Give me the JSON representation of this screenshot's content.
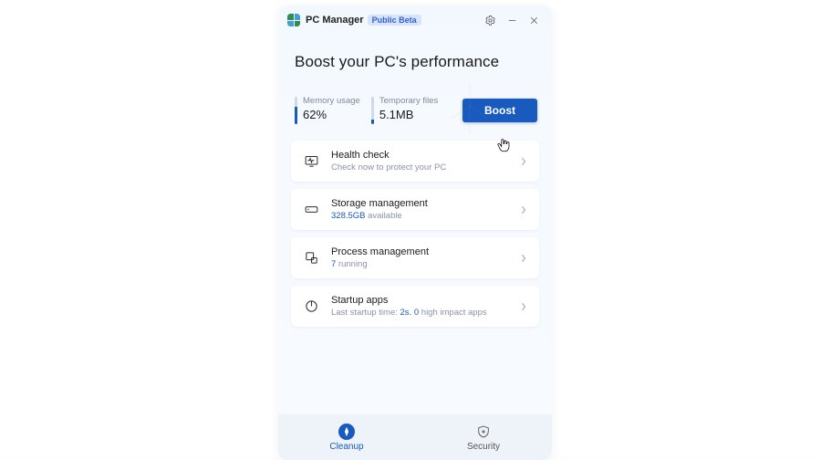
{
  "titlebar": {
    "app_name": "PC Manager",
    "badge": "Public Beta"
  },
  "header": {
    "headline": "Boost your PC's performance"
  },
  "stats": {
    "memory": {
      "label": "Memory usage",
      "value": "62%"
    },
    "temp": {
      "label": "Temporary files",
      "value": "5.1MB"
    },
    "boost_label": "Boost"
  },
  "cards": {
    "health": {
      "title": "Health check",
      "subtitle": "Check now to protect your PC"
    },
    "storage": {
      "title": "Storage management",
      "available_value": "328.5GB",
      "available_suffix": " available"
    },
    "process": {
      "title": "Process management",
      "running_value": "7",
      "running_suffix": " running"
    },
    "startup": {
      "title": "Startup apps",
      "sub_prefix": "Last startup time: ",
      "sub_time": "2s.",
      "sub_mid": " ",
      "sub_count": "0",
      "sub_suffix": " high impact apps"
    }
  },
  "nav": {
    "cleanup": "Cleanup",
    "security": "Security"
  },
  "colors": {
    "accent": "#185abd"
  }
}
